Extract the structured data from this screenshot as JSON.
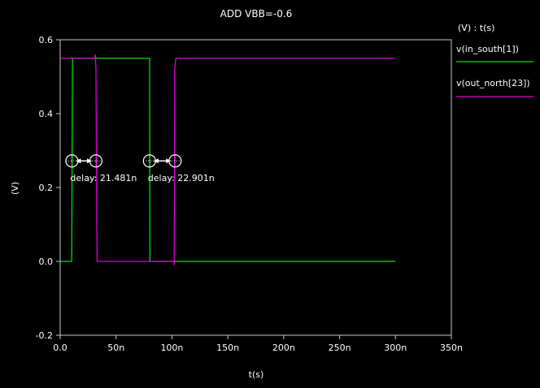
{
  "chart_data": {
    "type": "line",
    "title": "ADD VBB=-0.6",
    "xlabel": "t(s)",
    "ylabel": "(V)",
    "legend_title": "(V) : t(s)",
    "legend_position": "right",
    "grid": false,
    "xlim": [
      0,
      350
    ],
    "ylim": [
      -0.2,
      0.6
    ],
    "x_unit": "n",
    "x_ticks": [
      0,
      50,
      100,
      150,
      200,
      250,
      300,
      350
    ],
    "x_tick_labels": [
      "0.0",
      "50n",
      "100n",
      "150n",
      "200n",
      "250n",
      "300n",
      "350n"
    ],
    "y_ticks": [
      -0.2,
      0.0,
      0.2,
      0.4,
      0.6
    ],
    "y_tick_labels": [
      "-0.2",
      "0.0",
      "0.2",
      "0.4",
      "0.6"
    ],
    "series": [
      {
        "name": "v(in_south[1])",
        "color": "#00dd00",
        "x": [
          0,
          10.3,
          10.5,
          11.0,
          79.7,
          80.0,
          80.3,
          300
        ],
        "y": [
          0.0,
          0.0,
          0.14,
          0.55,
          0.55,
          0.55,
          0.0,
          0.0
        ]
      },
      {
        "name": "v(out_north[23])",
        "color": "#dd00dd",
        "x": [
          0,
          31.0,
          31.5,
          32.0,
          33.0,
          101.5,
          102.0,
          102.5,
          103.5,
          300
        ],
        "y": [
          0.55,
          0.55,
          0.56,
          0.52,
          0.0,
          0.0,
          -0.01,
          0.52,
          0.55,
          0.55
        ]
      }
    ],
    "annotations": [
      {
        "label": "delay: 21.481n",
        "x_start": 10.5,
        "x_end": 31.98,
        "y": 0.272
      },
      {
        "label": "delay: 22.901n",
        "x_start": 79.9,
        "x_end": 102.8,
        "y": 0.272
      }
    ]
  }
}
